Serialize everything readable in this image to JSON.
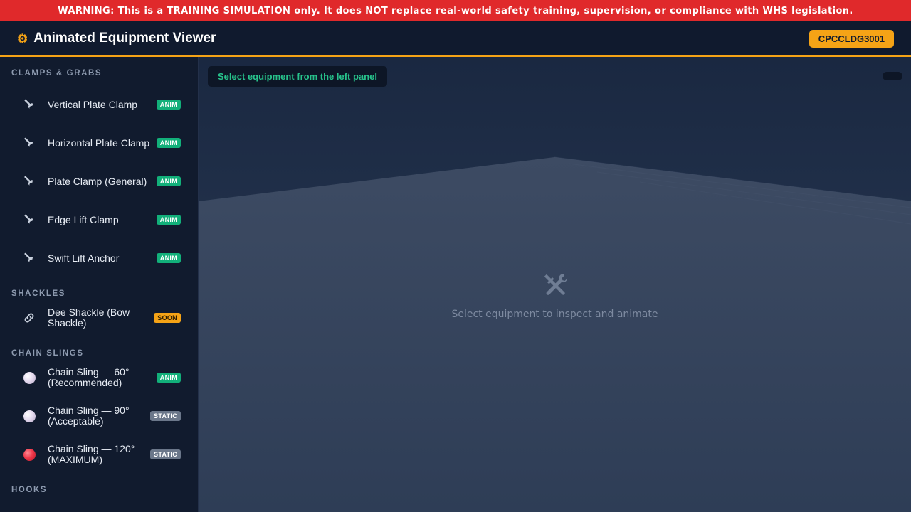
{
  "warning": "WARNING: This is a TRAINING SIMULATION only. It does NOT replace real-world safety training, supervision, or compliance with WHS legislation.",
  "header": {
    "title": "Animated Equipment Viewer",
    "icon": "gear-icon",
    "unit_code": "CPCCLDG3001"
  },
  "colors": {
    "accent": "#f5a316",
    "warning": "#e0292b",
    "anim_tag": "#12b07a",
    "static_tag": "#6b778a"
  },
  "sidebar": {
    "sections": [
      {
        "title": "CLAMPS & GRABS",
        "items": [
          {
            "label": "Vertical Plate Clamp",
            "tag": "ANIM",
            "icon": "wrench-icon"
          },
          {
            "label": "Horizontal Plate Clamp",
            "tag": "ANIM",
            "icon": "wrench-icon"
          },
          {
            "label": "Plate Clamp (General)",
            "tag": "ANIM",
            "icon": "wrench-icon"
          },
          {
            "label": "Edge Lift Clamp",
            "tag": "ANIM",
            "icon": "wrench-icon"
          },
          {
            "label": "Swift Lift Anchor",
            "tag": "ANIM",
            "icon": "wrench-icon"
          }
        ]
      },
      {
        "title": "SHACKLES",
        "items": [
          {
            "label": "Dee Shackle (Bow Shackle)",
            "tag": "SOON",
            "icon": "link-icon"
          }
        ]
      },
      {
        "title": "CHAIN SLINGS",
        "items": [
          {
            "label": "Chain Sling — 60° (Recommended)",
            "tag": "ANIM",
            "icon": "white-sphere-icon"
          },
          {
            "label": "Chain Sling — 90° (Acceptable)",
            "tag": "STATIC",
            "icon": "white-sphere-icon"
          },
          {
            "label": "Chain Sling — 120° (MAXIMUM)",
            "tag": "STATIC",
            "icon": "red-sphere-icon"
          }
        ]
      },
      {
        "title": "HOOKS",
        "items": []
      }
    ]
  },
  "viewer": {
    "hint": "Select equipment from the left panel",
    "placeholder_icon": "hammer-wrench-icon",
    "placeholder_text": "Select equipment to inspect and animate"
  }
}
